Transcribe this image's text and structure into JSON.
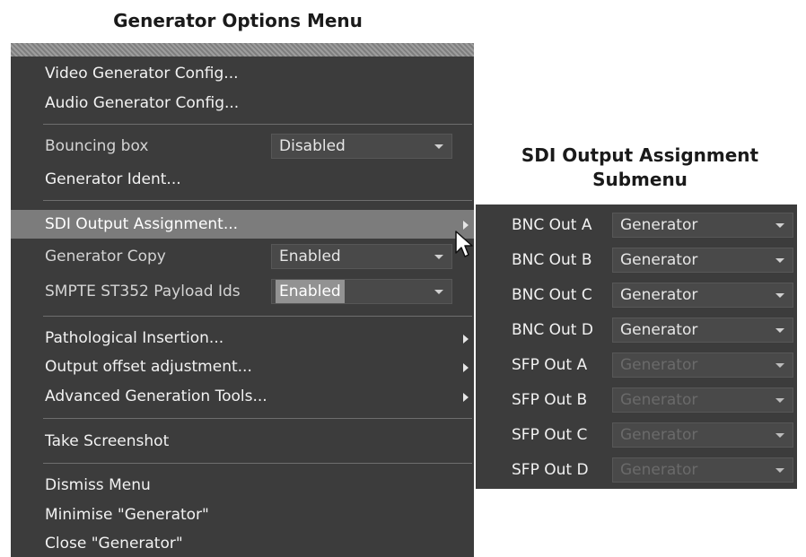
{
  "captions": {
    "main": "Generator Options Menu",
    "sub": "SDI Output Assignment Submenu"
  },
  "menu": {
    "video_generator_config": "Video Generator Config...",
    "audio_generator_config": "Audio Generator Config...",
    "bouncing_box": {
      "label": "Bouncing box",
      "value": "Disabled"
    },
    "generator_ident": "Generator Ident...",
    "sdi_output_assignment": "SDI Output Assignment...",
    "generator_copy": {
      "label": "Generator Copy",
      "value": "Enabled"
    },
    "smpte_payload": {
      "label": "SMPTE ST352 Payload Ids",
      "value": "Enabled"
    },
    "pathological_insertion": "Pathological Insertion...",
    "output_offset": "Output offset adjustment...",
    "advanced_tools": "Advanced Generation Tools...",
    "take_screenshot": "Take Screenshot",
    "dismiss_menu": "Dismiss Menu",
    "minimise": "Minimise \"Generator\"",
    "close": "Close \"Generator\""
  },
  "submenu": {
    "rows": [
      {
        "label": "BNC Out A",
        "value": "Generator",
        "enabled": true
      },
      {
        "label": "BNC Out B",
        "value": "Generator",
        "enabled": true
      },
      {
        "label": "BNC Out C",
        "value": "Generator",
        "enabled": true
      },
      {
        "label": "BNC Out D",
        "value": "Generator",
        "enabled": true
      },
      {
        "label": "SFP Out A",
        "value": "Generator",
        "enabled": false
      },
      {
        "label": "SFP Out B",
        "value": "Generator",
        "enabled": false
      },
      {
        "label": "SFP Out C",
        "value": "Generator",
        "enabled": false
      },
      {
        "label": "SFP Out D",
        "value": "Generator",
        "enabled": false
      }
    ]
  },
  "icons": {
    "submenu_arrow": "chevron-right-icon",
    "dropdown": "chevron-down-icon",
    "pointer": "mouse-pointer-icon"
  },
  "colors": {
    "menu_background": "#3c3c3c",
    "highlight": "#7c7c7c",
    "text": "#f2f2f2",
    "disabled_text": "#6a6a6a"
  }
}
